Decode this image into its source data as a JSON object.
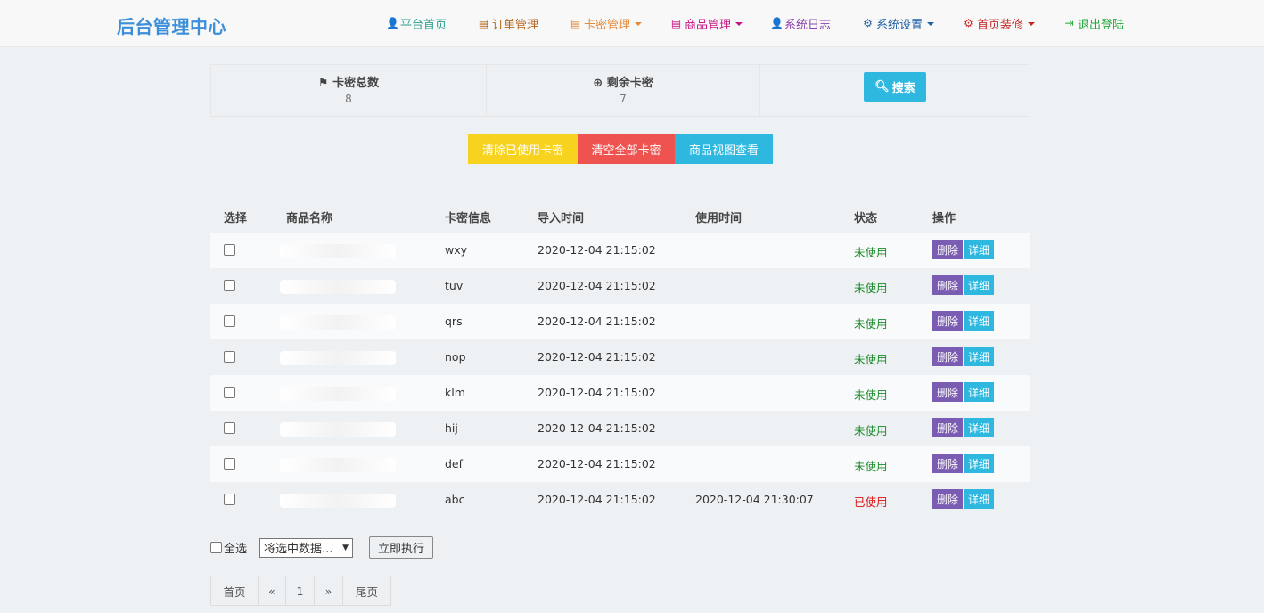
{
  "app": {
    "brand": "后台管理中心"
  },
  "nav": [
    {
      "label": "平台首页",
      "icon": "user-icon",
      "glyph": "👤",
      "color": "#2a9d8f",
      "caret": false
    },
    {
      "label": "订单管理",
      "icon": "list-icon",
      "glyph": "▤",
      "color": "#b5651d",
      "caret": false
    },
    {
      "label": "卡密管理",
      "icon": "book-icon",
      "glyph": "▤",
      "color": "#e58a3a",
      "caret": true
    },
    {
      "label": "商品管理",
      "icon": "book-icon",
      "glyph": "▤",
      "color": "#c71585",
      "caret": true
    },
    {
      "label": "系统日志",
      "icon": "user-icon",
      "glyph": "👤",
      "color": "#8e44ad",
      "caret": false
    },
    {
      "label": "系统设置",
      "icon": "gear-icon",
      "glyph": "⚙",
      "color": "#1f5fa6",
      "caret": true
    },
    {
      "label": "首页装修",
      "icon": "gear-icon",
      "glyph": "⚙",
      "color": "#c62828",
      "caret": true
    },
    {
      "label": "退出登陆",
      "icon": "logout-icon",
      "glyph": "⇥",
      "color": "#22a83a",
      "caret": false
    }
  ],
  "stats": {
    "total_label": "卡密总数",
    "total_value": "8",
    "remain_label": "剩余卡密",
    "remain_value": "7",
    "search_label": "搜索"
  },
  "actions": {
    "clear_used": "清除已使用卡密",
    "clear_all": "清空全部卡密",
    "goods_view": "商品视图查看"
  },
  "table": {
    "headers": [
      "选择",
      "商品名称",
      "卡密信息",
      "导入时间",
      "使用时间",
      "状态",
      "操作"
    ],
    "rows": [
      {
        "card": "wxy",
        "import_time": "2020-12-04 21:15:02",
        "use_time": "",
        "status": "未使用",
        "used": false
      },
      {
        "card": "tuv",
        "import_time": "2020-12-04 21:15:02",
        "use_time": "",
        "status": "未使用",
        "used": false
      },
      {
        "card": "qrs",
        "import_time": "2020-12-04 21:15:02",
        "use_time": "",
        "status": "未使用",
        "used": false
      },
      {
        "card": "nop",
        "import_time": "2020-12-04 21:15:02",
        "use_time": "",
        "status": "未使用",
        "used": false
      },
      {
        "card": "klm",
        "import_time": "2020-12-04 21:15:02",
        "use_time": "",
        "status": "未使用",
        "used": false
      },
      {
        "card": "hij",
        "import_time": "2020-12-04 21:15:02",
        "use_time": "",
        "status": "未使用",
        "used": false
      },
      {
        "card": "def",
        "import_time": "2020-12-04 21:15:02",
        "use_time": "",
        "status": "未使用",
        "used": false
      },
      {
        "card": "abc",
        "import_time": "2020-12-04 21:15:02",
        "use_time": "2020-12-04 21:30:07",
        "status": "已使用",
        "used": true
      }
    ],
    "delete_label": "删除",
    "detail_label": "详细"
  },
  "bulk": {
    "select_all": "全选",
    "select_value": "将选中数据...",
    "execute": "立即执行"
  },
  "pagination": {
    "first": "首页",
    "prev": "«",
    "page": "1",
    "next": "»",
    "last": "尾页"
  }
}
